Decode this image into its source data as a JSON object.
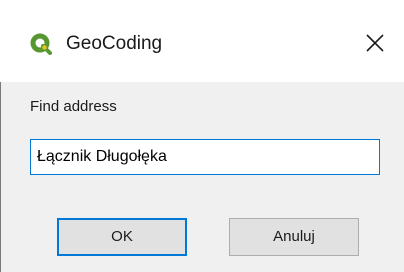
{
  "window": {
    "title": "GeoCoding",
    "app_icon": "qgis-logo-icon",
    "close_icon": "close-icon"
  },
  "form": {
    "label": "Find address",
    "address_value": "Łącznik Długołęka"
  },
  "buttons": {
    "ok_label": "OK",
    "cancel_label": "Anuluj"
  },
  "colors": {
    "accent": "#0078d7",
    "qgis_green": "#589632",
    "qgis_yellow": "#ee7913"
  }
}
